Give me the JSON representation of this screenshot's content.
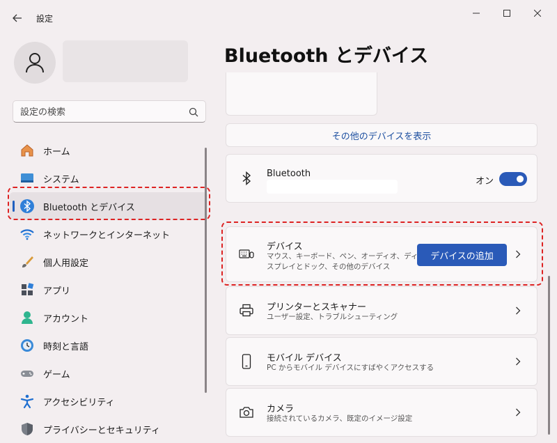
{
  "window": {
    "title": "設定",
    "controls": {
      "minimize_icon": "minimize-icon",
      "maximize_icon": "maximize-icon",
      "close_icon": "close-icon"
    }
  },
  "sidebar": {
    "search": {
      "placeholder": "設定の検索",
      "icon": "search-icon"
    },
    "items": [
      {
        "label": "ホーム",
        "icon": "home-icon",
        "selected": false
      },
      {
        "label": "システム",
        "icon": "system-icon",
        "selected": false
      },
      {
        "label": "Bluetooth とデバイス",
        "icon": "bluetooth-icon",
        "selected": true
      },
      {
        "label": "ネットワークとインターネット",
        "icon": "wifi-icon",
        "selected": false
      },
      {
        "label": "個人用設定",
        "icon": "brush-icon",
        "selected": false
      },
      {
        "label": "アプリ",
        "icon": "apps-icon",
        "selected": false
      },
      {
        "label": "アカウント",
        "icon": "account-icon",
        "selected": false
      },
      {
        "label": "時刻と言語",
        "icon": "clock-globe-icon",
        "selected": false
      },
      {
        "label": "ゲーム",
        "icon": "gamepad-icon",
        "selected": false
      },
      {
        "label": "アクセシビリティ",
        "icon": "accessibility-icon",
        "selected": false
      },
      {
        "label": "プライバシーとセキュリティ",
        "icon": "shield-icon",
        "selected": false
      }
    ]
  },
  "main": {
    "title": "Bluetooth とデバイス",
    "show_more_link": "その他のデバイスを表示",
    "bluetooth": {
      "title": "Bluetooth",
      "toggle_label": "オン",
      "toggle_on": true
    },
    "rows": {
      "devices": {
        "title": "デバイス",
        "desc": "マウス、キーボード、ペン、オーディオ、ディスプレイとドック、その他のデバイス",
        "button": "デバイスの追加"
      },
      "printers": {
        "title": "プリンターとスキャナー",
        "desc": "ユーザー設定、トラブルシューティング"
      },
      "mobile": {
        "title": "モバイル デバイス",
        "desc": "PC からモバイル デバイスにすばやくアクセスする"
      },
      "camera": {
        "title": "カメラ",
        "desc": "接続されているカメラ、既定のイメージ設定"
      }
    }
  },
  "colors": {
    "accent": "#2a5ab8",
    "link": "#1d4fa0",
    "annotation": "#dd2222"
  }
}
